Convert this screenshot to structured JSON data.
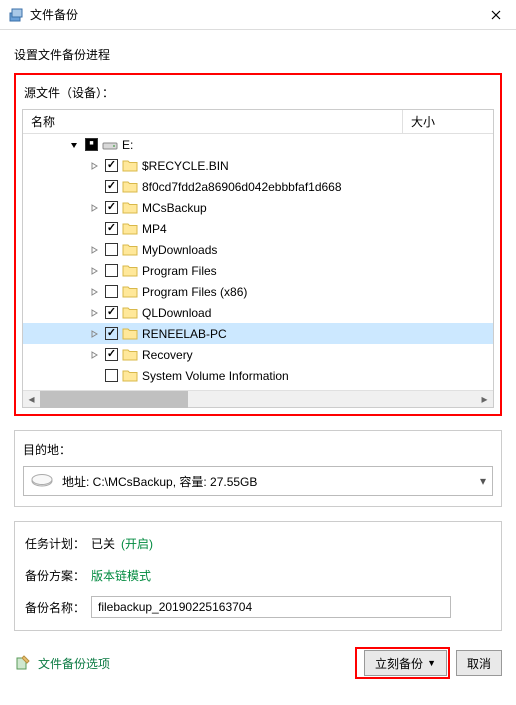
{
  "titlebar": {
    "title": "文件备份"
  },
  "heading": "设置文件备份进程",
  "source": {
    "label": "源文件（设备）：",
    "columns": {
      "name": "名称",
      "size": "大小"
    },
    "root": {
      "label": "E:"
    },
    "items": [
      {
        "label": "$RECYCLE.BIN",
        "checked": true,
        "expandable": true
      },
      {
        "label": "8f0cd7fdd2a86906d042ebbbfaf1d668",
        "checked": true,
        "expandable": false
      },
      {
        "label": "MCsBackup",
        "checked": true,
        "expandable": true
      },
      {
        "label": "MP4",
        "checked": true,
        "expandable": false
      },
      {
        "label": "MyDownloads",
        "checked": false,
        "expandable": true
      },
      {
        "label": "Program Files",
        "checked": false,
        "expandable": true
      },
      {
        "label": "Program Files (x86)",
        "checked": false,
        "expandable": true
      },
      {
        "label": "QLDownload",
        "checked": true,
        "expandable": true
      },
      {
        "label": "RENEELAB-PC",
        "checked": true,
        "expandable": true,
        "selected": true
      },
      {
        "label": "Recovery",
        "checked": true,
        "expandable": true
      },
      {
        "label": "System Volume Information",
        "checked": false,
        "expandable": false
      }
    ]
  },
  "destination": {
    "label": "目的地：",
    "text": "地址: C:\\MCsBackup, 容量: 27.55GB"
  },
  "plan": {
    "task_label": "任务计划：",
    "task_value": "已关",
    "task_link": "(开启)",
    "scheme_label": "备份方案：",
    "scheme_link": "版本链模式",
    "name_label": "备份名称：",
    "name_value": "filebackup_20190225163704"
  },
  "footer": {
    "options_link": "文件备份选项",
    "backup_now": "立刻备份",
    "cancel": "取消"
  }
}
